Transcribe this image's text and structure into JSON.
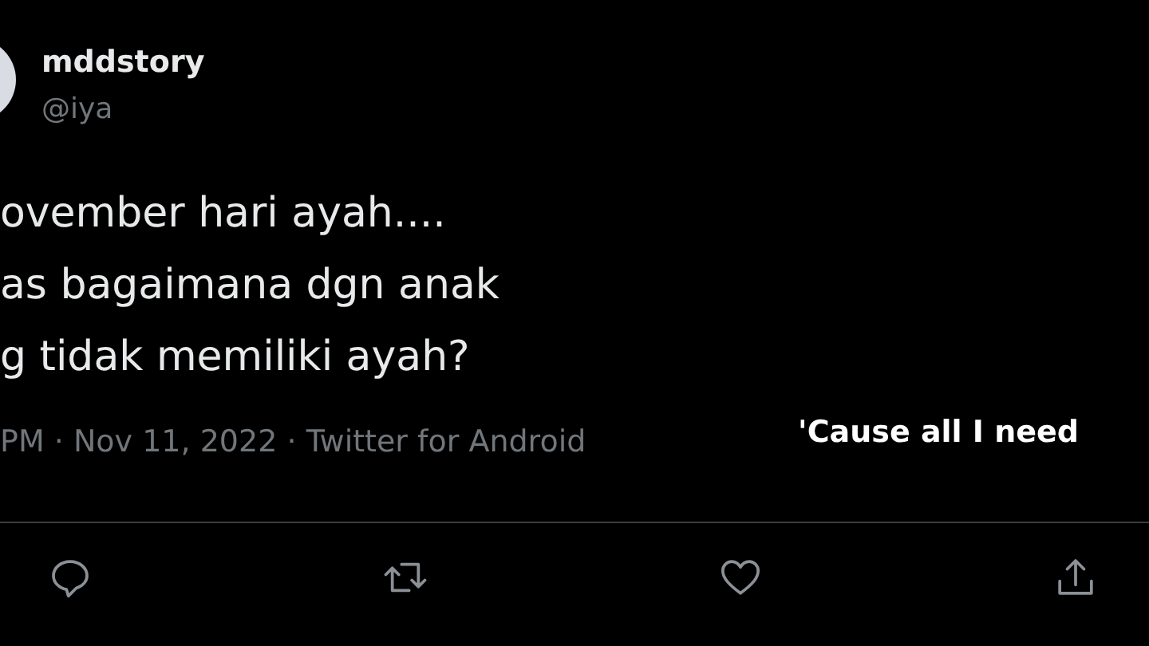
{
  "tweet": {
    "display_name": "mddstory",
    "handle": "@iya",
    "text_lines": [
      "ovember hari ayah....",
      "as bagaimana dgn anak",
      "g tidak memiliki ayah?"
    ],
    "meta": "PM · Nov 11, 2022 · Twitter for Android"
  },
  "caption": "'Cause all I need",
  "actions": [
    {
      "kind": "reply"
    },
    {
      "kind": "retweet"
    },
    {
      "kind": "like"
    },
    {
      "kind": "share"
    }
  ]
}
